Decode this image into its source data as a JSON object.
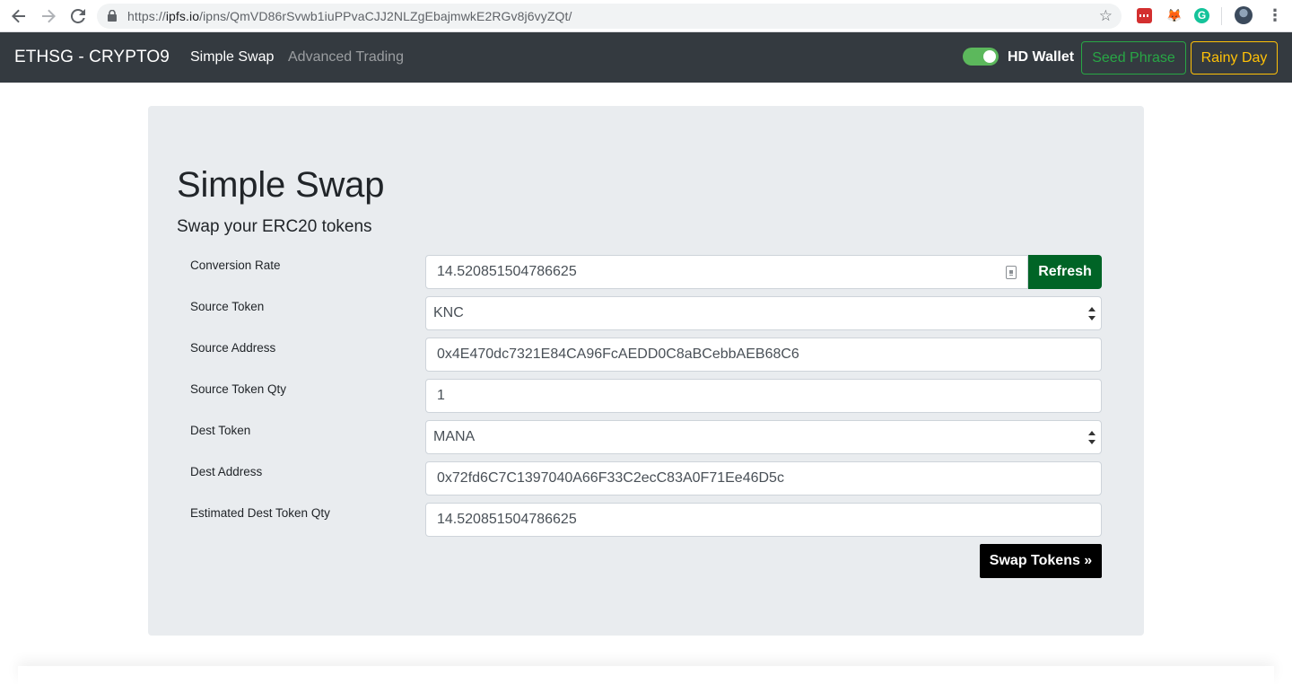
{
  "browser": {
    "url_scheme": "https://",
    "url_host": "ipfs.io",
    "url_path": "/ipns/QmVD86rSvwb1iuPPvaCJJ2NLZgEbajmwkE2RGv8j6vyZQt/",
    "star_icon": "star-icon",
    "extension_icons": [
      "lastpass-icon",
      "metamask-icon",
      "grammarly-icon"
    ]
  },
  "navbar": {
    "brand": "ETHSG - CRYPTO9",
    "links": [
      {
        "label": "Simple Swap",
        "active": true
      },
      {
        "label": "Advanced Trading",
        "active": false
      }
    ],
    "toggle_on": true,
    "toggle_label": "HD Wallet",
    "seed_button": "Seed Phrase",
    "rainy_button": "Rainy Day"
  },
  "main": {
    "title": "Simple Swap",
    "subtitle": "Swap your ERC20 tokens",
    "fields": [
      {
        "label": "Conversion Rate",
        "value": "14.520851504786625",
        "type": "readonly"
      },
      {
        "label": "Source Token",
        "value": "KNC",
        "type": "select"
      },
      {
        "label": "Source Address",
        "value": "0x4E470dc7321E84CA96FcAEDD0C8aBCebbAEB68C6",
        "type": "input"
      },
      {
        "label": "Source Token Qty",
        "value": "1",
        "type": "input"
      },
      {
        "label": "Dest Token",
        "value": "MANA",
        "type": "select"
      },
      {
        "label": "Dest Address",
        "value": "0x72fd6C7C1397040A66F33C2ecC83A0F71Ee46D5c",
        "type": "input"
      },
      {
        "label": "Estimated Dest Token Qty",
        "value": "14.520851504786625",
        "type": "readonly"
      }
    ],
    "refresh_button": "Refresh",
    "swap_button": "Swap Tokens »"
  },
  "colors": {
    "navbar_bg": "#343a40",
    "jumbotron_bg": "#e9ecef",
    "refresh_bg": "#006426",
    "seed_outline": "#28a745",
    "rainy_outline": "#ffc107",
    "toggle_on": "#5cb85c"
  }
}
